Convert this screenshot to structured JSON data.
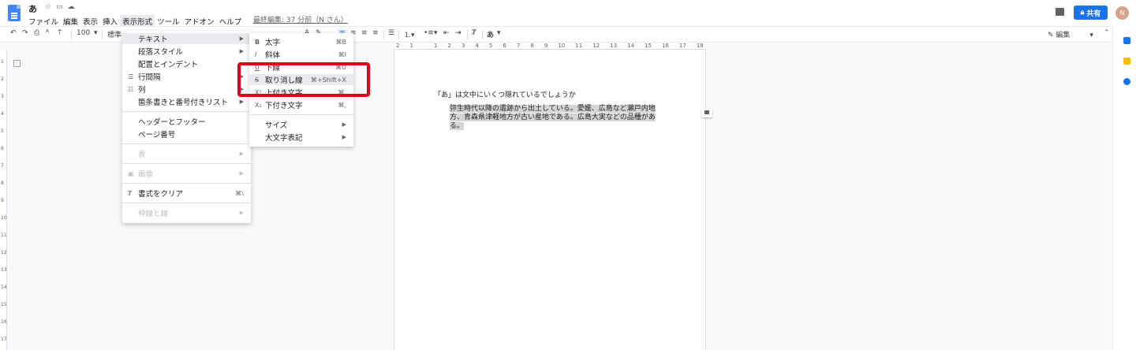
{
  "document": {
    "title": "あ",
    "last_edit": "最終編集: 37 分前（N さん）"
  },
  "menubar": [
    "ファイル",
    "編集",
    "表示",
    "挿入",
    "表示形式",
    "ツール",
    "アドオン",
    "ヘルプ"
  ],
  "toolbar": {
    "zoom": "100",
    "style": "標準",
    "edit_mode": "編集",
    "input_tool": "あ"
  },
  "header": {
    "share_label": "共有",
    "avatar_initial": "N"
  },
  "format_menu": {
    "items": [
      {
        "label": "テキスト",
        "submenu": true,
        "highlighted": true
      },
      {
        "label": "段落スタイル",
        "submenu": true
      },
      {
        "label": "配置とインデント",
        "submenu": true
      },
      {
        "label": "行間隔",
        "submenu": true,
        "icon": "line-spacing-icon"
      },
      {
        "label": "列",
        "submenu": true,
        "icon": "columns-icon"
      },
      {
        "label": "箇条書きと番号付きリスト",
        "submenu": true
      },
      {
        "label": "ヘッダーとフッター"
      },
      {
        "label": "ページ番号"
      },
      {
        "label": "表",
        "submenu": true,
        "disabled": true
      },
      {
        "label": "画像",
        "submenu": true,
        "disabled": true,
        "icon": "image-icon"
      },
      {
        "label": "書式をクリア",
        "shortcut": "⌘\\",
        "icon": "clear-format-icon"
      },
      {
        "label": "枠線と線",
        "submenu": true,
        "disabled": true
      }
    ]
  },
  "text_submenu": {
    "items": [
      {
        "label": "太字",
        "shortcut": "⌘B",
        "icon_text": "B"
      },
      {
        "label": "斜体",
        "shortcut": "⌘I",
        "icon_text": "I"
      },
      {
        "label": "下線",
        "shortcut": "⌘U",
        "icon_text": "U"
      },
      {
        "label": "取り消し線",
        "shortcut": "⌘+Shift+X",
        "icon_text": "S",
        "highlighted": true
      },
      {
        "label": "上付き文字",
        "shortcut": "⌘.",
        "icon_text": "X²"
      },
      {
        "label": "下付き文字",
        "shortcut": "⌘,",
        "icon_text": "X₂"
      },
      {
        "label": "サイズ",
        "submenu": true
      },
      {
        "label": "大文字表記",
        "submenu": true
      }
    ]
  },
  "ruler": {
    "marks": [
      "2",
      "1",
      "",
      "1",
      "2",
      "3",
      "4",
      "5",
      "6",
      "7",
      "8",
      "9",
      "10",
      "11",
      "12",
      "13",
      "14",
      "15",
      "16",
      "17",
      "18"
    ],
    "vertical": [
      "1",
      "2",
      "3",
      "4",
      "5",
      "6",
      "7",
      "8",
      "9",
      "10",
      "11",
      "12",
      "13",
      "14",
      "15",
      "16",
      "17"
    ]
  },
  "content": {
    "heading": "「あ」は文中にいくつ隠れているでしょうか",
    "paragraph": "弥生時代以降の遺跡から出土している。愛媛、広島など瀬戸内地方、青森県津軽地方が古い産地である。広島大実などの品種がある。"
  },
  "colors": {
    "accent": "#1a73e8",
    "annotation_box": "#e0001b",
    "selection": "#d5d5d5"
  }
}
